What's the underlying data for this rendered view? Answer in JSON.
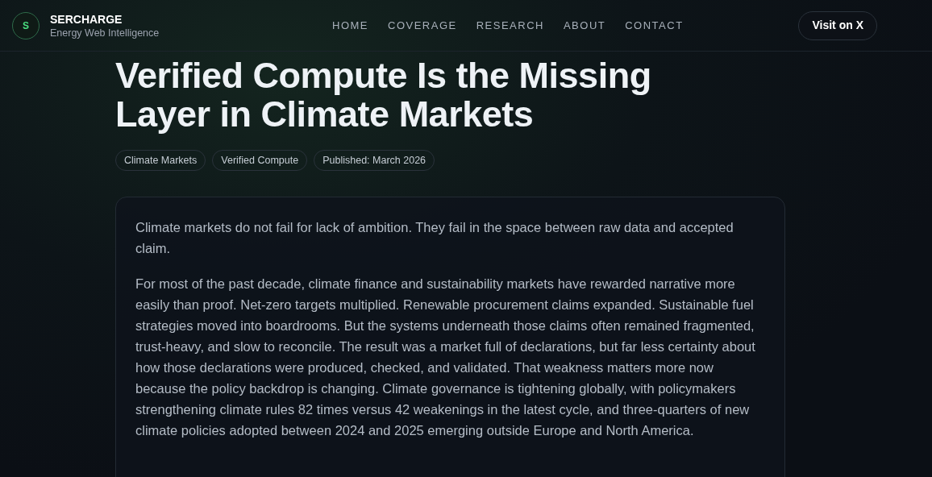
{
  "header": {
    "logo_letter": "S",
    "brand": "SERCHARGE",
    "tagline": "Energy Web Intelligence",
    "nav": [
      "HOME",
      "COVERAGE",
      "RESEARCH",
      "ABOUT",
      "CONTACT"
    ],
    "cta": "Visit on X"
  },
  "article": {
    "title": "Verified Compute Is the Missing Layer in Climate Markets",
    "tags": [
      "Climate Markets",
      "Verified Compute",
      "Published: March 2026"
    ],
    "paragraphs": [
      "Climate markets do not fail for lack of ambition. They fail in the space between raw data and accepted claim.",
      "For most of the past decade, climate finance and sustainability markets have rewarded narrative more easily than proof. Net-zero targets multiplied. Renewable procurement claims expanded. Sustainable fuel strategies moved into boardrooms. But the systems underneath those claims often remained fragmented, trust-heavy, and slow to reconcile. The result was a market full of declarations, but far less certainty about how those declarations were produced, checked, and validated. That weakness matters more now because the policy backdrop is changing. Climate governance is tightening globally, with policymakers strengthening climate rules 82 times versus 42 weakenings in the latest cycle, and three-quarters of new climate policies adopted between 2024 and 2025 emerging outside Europe and North America."
    ]
  }
}
